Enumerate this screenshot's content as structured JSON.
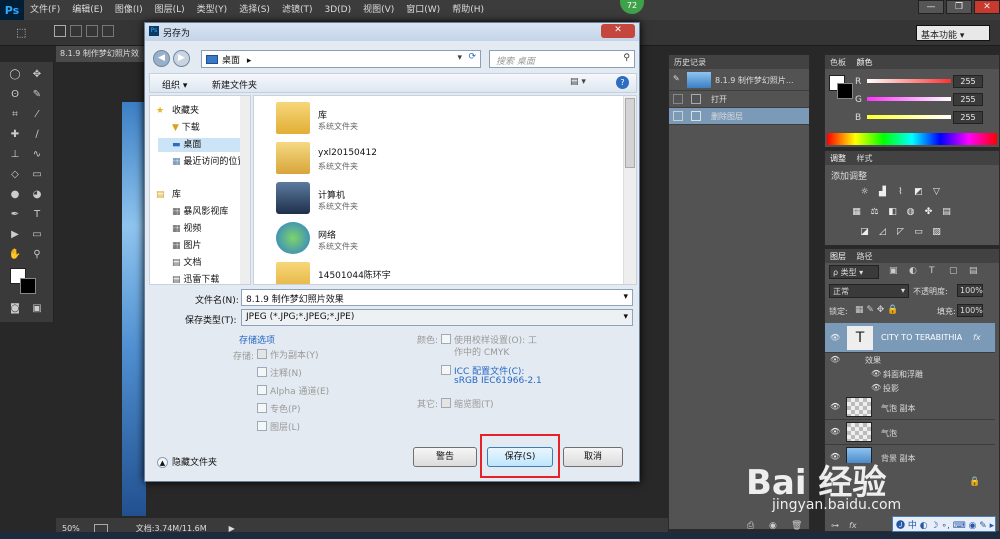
{
  "app": {
    "logo": "Ps",
    "menus": [
      "文件(F)",
      "编辑(E)",
      "图像(I)",
      "图层(L)",
      "类型(Y)",
      "选择(S)",
      "滤镜(T)",
      "3D(D)",
      "视图(V)",
      "窗口(W)",
      "帮助(H)"
    ],
    "badge": "72",
    "workspace": "基本功能",
    "doc_tab": "8.1.9 制作梦幻照片效",
    "zoom": "50%",
    "doc_info": "文档:3.74M/11.6M"
  },
  "dialog": {
    "title": "另存为",
    "address": "桌面",
    "address_arrow": "▸",
    "search_placeholder": "搜索 桌面",
    "organize": "组织 ▾",
    "new_folder": "新建文件夹",
    "nav": {
      "favorites_header": "收藏夹",
      "favorites": [
        "下载",
        "桌面",
        "最近访问的位置"
      ],
      "library_header": "库",
      "libraries": [
        "暴风影视库",
        "视频",
        "图片",
        "文档",
        "迅雷下载"
      ]
    },
    "files": [
      {
        "name": "库",
        "desc": "系统文件夹"
      },
      {
        "name": "yxl20150412",
        "desc": "系统文件夹"
      },
      {
        "name": "计算机",
        "desc": "系统文件夹"
      },
      {
        "name": "网络",
        "desc": "系统文件夹"
      },
      {
        "name": "14501044陈环宇",
        "desc": ""
      }
    ],
    "filename_label": "文件名(N):",
    "filename_value": "8.1.9 制作梦幻照片效果",
    "filetype_label": "保存类型(T):",
    "filetype_value": "JPEG (*.JPG;*.JPEG;*.JPE)",
    "save_options": "存储选项",
    "store_label": "存储:",
    "store_options": [
      "作为副本(Y)",
      "注释(N)",
      "Alpha 通道(E)",
      "专色(P)",
      "图层(L)"
    ],
    "color_label": "颜色:",
    "proof_setup": "使用校样设置(O): 工",
    "proof_setup2": "作中的 CMYK",
    "icc_profile": "ICC 配置文件(C):",
    "icc_value": "sRGB IEC61966-2.1",
    "other_label": "其它:",
    "thumbnail": "缩览图(T)",
    "hide_folders": "隐藏文件夹",
    "warning_button": "警告",
    "save_button": "保存(S)",
    "cancel_button": "取消"
  },
  "history": {
    "tab": "历史记录",
    "snapshot": "8.1.9 制作梦幻照片...",
    "items": [
      "打开",
      "删除图层"
    ]
  },
  "color_panel": {
    "tabs": [
      "色板",
      "颜色"
    ],
    "channels": [
      {
        "label": "R",
        "value": "255",
        "color": "#ff3030"
      },
      {
        "label": "G",
        "value": "255",
        "color": "#30ff30"
      },
      {
        "label": "B",
        "value": "255",
        "color": "#3030ff"
      }
    ]
  },
  "adjust_panel": {
    "tabs": [
      "调整",
      "样式"
    ],
    "title": "添加调整"
  },
  "layers_panel": {
    "tabs": [
      "图层",
      "路径"
    ],
    "filter": "ρ 类型",
    "blend_mode": "正常",
    "opacity_label": "不透明度:",
    "opacity_value": "100%",
    "lock_label": "锁定:",
    "fill_label": "填充:",
    "fill_value": "100%",
    "text_layer": "CITY TO TERABITHIA",
    "effects": "效果",
    "effect_items": [
      "斜面和浮雕",
      "投影"
    ],
    "layers": [
      "气泡 副本",
      "气泡",
      "背景 副本"
    ]
  },
  "watermark": {
    "brand": "Bai 经验",
    "url": "jingyan.baidu.com"
  }
}
